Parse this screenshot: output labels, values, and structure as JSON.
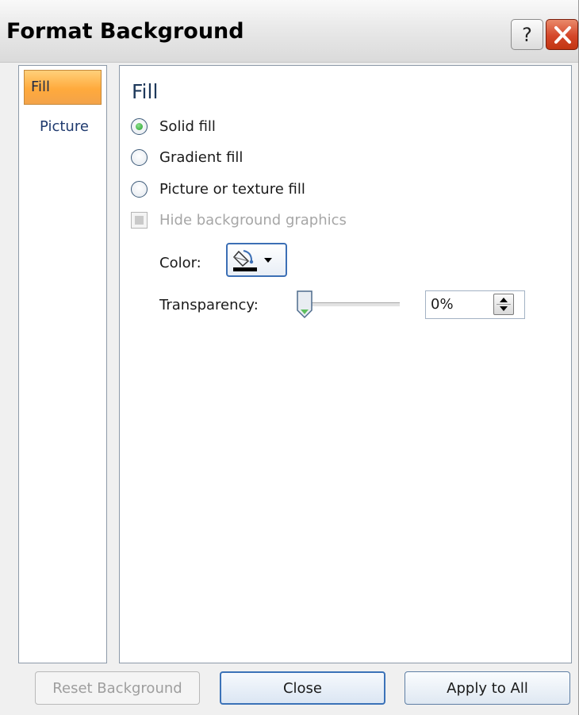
{
  "window": {
    "title": "Format Background",
    "help_glyph": "?"
  },
  "nav": {
    "items": [
      {
        "label": "Fill",
        "selected": true
      },
      {
        "label": "Picture",
        "selected": false
      }
    ]
  },
  "content": {
    "section_title": "Fill",
    "options": [
      {
        "label": "Solid fill",
        "checked": true
      },
      {
        "label": "Gradient fill",
        "checked": false
      },
      {
        "label": "Picture or texture fill",
        "checked": false
      }
    ],
    "hide_background": {
      "label": "Hide background graphics",
      "enabled": false,
      "state": "indeterminate"
    },
    "color": {
      "label": "Color:",
      "value": "#000000",
      "icon": "paint-bucket-icon"
    },
    "transparency": {
      "label": "Transparency:",
      "value": "0%",
      "level": 0
    }
  },
  "buttons": {
    "reset": "Reset Background",
    "close": "Close",
    "apply": "Apply to All"
  },
  "colors": {
    "accent": "#3b72b8",
    "selected_nav": "#ffaa3c",
    "close_button": "#d4472a"
  }
}
